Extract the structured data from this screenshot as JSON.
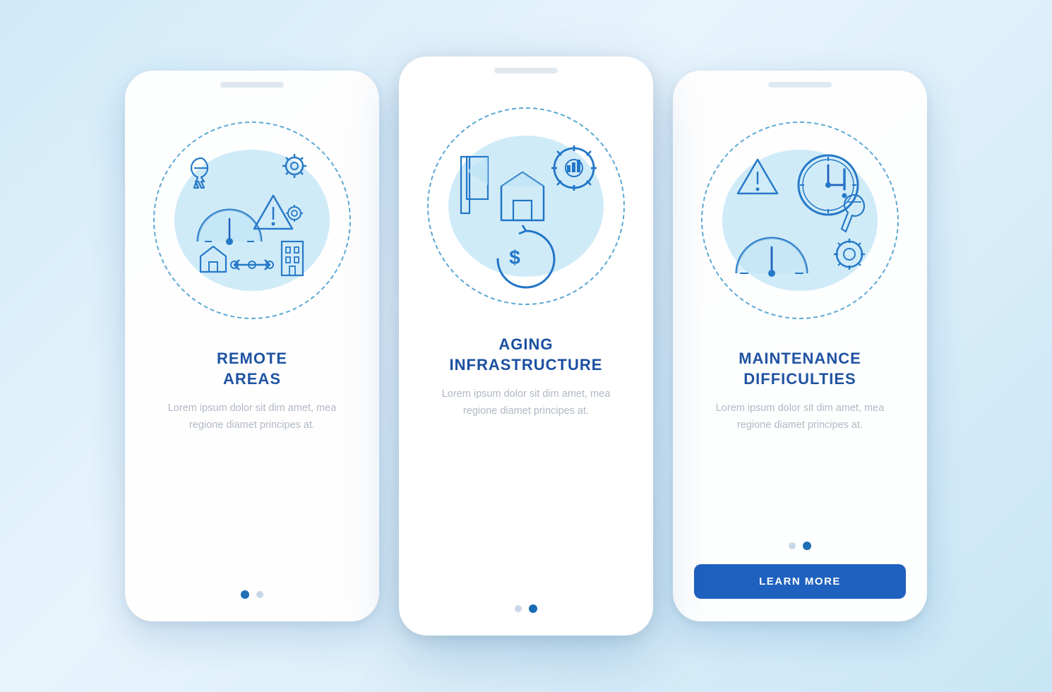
{
  "background": {
    "gradient_start": "#d0eaf8",
    "gradient_end": "#c8e6f5"
  },
  "phones": [
    {
      "id": "remote-areas",
      "title": "REMOTE\nAREAS",
      "body_text": "Lorem ipsum dolor sit dim amet, mea regione diamet principes at.",
      "dots": [
        "inactive",
        "inactive"
      ],
      "button": null,
      "position": "left"
    },
    {
      "id": "aging-infrastructure",
      "title": "AGING\nINFRASTRUCTURE",
      "body_text": "Lorem ipsum dolor sit dim amet, mea regione diamet principes at.",
      "dots": [
        "inactive",
        "active"
      ],
      "button": null,
      "position": "middle"
    },
    {
      "id": "maintenance-difficulties",
      "title": "MAINTENANCE\nDIFFICULTIES",
      "body_text": "Lorem ipsum dolor sit dim amet, mea regione diamet principes at.",
      "dots": [
        "inactive",
        "active"
      ],
      "button_label": "LEARN MORE",
      "position": "right"
    }
  ]
}
